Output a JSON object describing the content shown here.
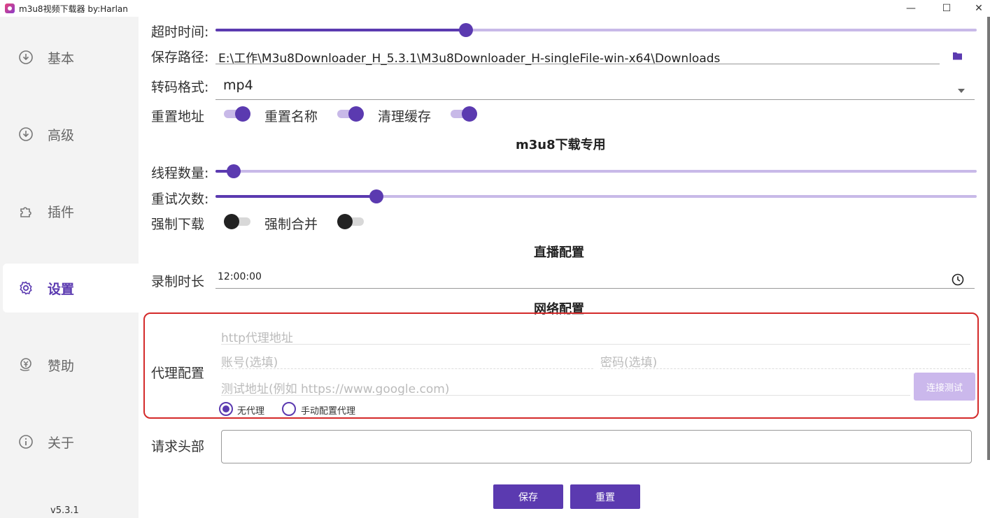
{
  "window": {
    "title": "m3u8视频下载器 by:Harlan",
    "minimize": "—",
    "maximize": "☐",
    "close": "✕"
  },
  "sidebar": {
    "items": [
      {
        "label": "基本",
        "icon": "download-circle-icon"
      },
      {
        "label": "高级",
        "icon": "download-circle-icon"
      },
      {
        "label": "插件",
        "icon": "puzzle-icon"
      },
      {
        "label": "设置",
        "icon": "gear-icon",
        "active": true
      },
      {
        "label": "赞助",
        "icon": "donate-icon"
      },
      {
        "label": "关于",
        "icon": "info-icon"
      }
    ],
    "version": "v5.3.1"
  },
  "settings": {
    "timeout": {
      "label": "超时时间:",
      "value": 0.329
    },
    "save_path": {
      "label": "保存路径:",
      "value": "E:\\工作\\M3u8Downloader_H_5.3.1\\M3u8Downloader_H-singleFile-win-x64\\Downloads",
      "icon": "folder-icon"
    },
    "format": {
      "label": "转码格式:",
      "value": "mp4",
      "icon": "dropdown-arrow-icon"
    },
    "reset_url": {
      "label": "重置地址",
      "on": true
    },
    "reset_name": {
      "label": "重置名称",
      "on": true
    },
    "clear_cache": {
      "label": "清理缓存",
      "on": true
    }
  },
  "m3u8_section": {
    "title": "m3u8下载专用",
    "threads": {
      "label": "线程数量:",
      "value": 0.024
    },
    "retries": {
      "label": "重试次数:",
      "value": 0.211
    },
    "force_download": {
      "label": "强制下载",
      "on": false
    },
    "force_merge": {
      "label": "强制合并",
      "on": false
    }
  },
  "live_section": {
    "title": "直播配置",
    "record_duration": {
      "label": "录制时长",
      "value": "12:00:00",
      "icon": "clock-icon"
    }
  },
  "network_section": {
    "title": "网络配置",
    "proxy_label": "代理配置",
    "proxy_address_placeholder": "http代理地址",
    "username_placeholder": "账号(选填)",
    "password_placeholder": "密码(选填)",
    "test_url_placeholder": "测试地址(例如 https://www.google.com)",
    "test_button": "连接测试",
    "no_proxy": "无代理",
    "manual_proxy": "手动配置代理",
    "selected": "no_proxy"
  },
  "headers": {
    "label": "请求头部",
    "value": ""
  },
  "actions": {
    "save": "保存",
    "reset": "重置"
  },
  "colors": {
    "accent": "#5b3ab0",
    "accent_light": "#c8b9e8",
    "highlight_border": "#d42a2a"
  }
}
